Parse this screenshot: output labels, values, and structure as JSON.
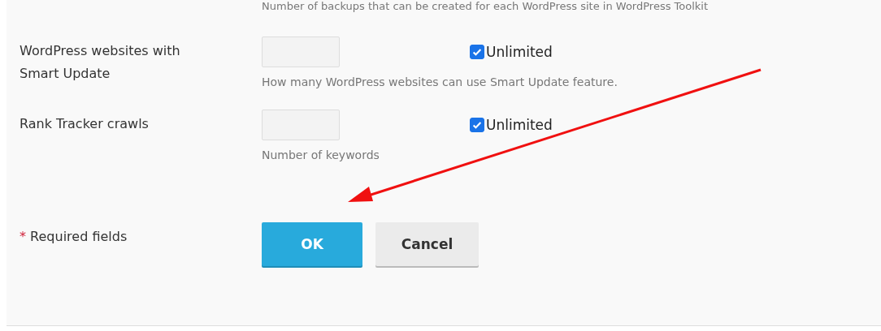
{
  "top_hint": "Number of backups that can be created for each WordPress site in WordPress Toolkit",
  "rows": [
    {
      "label": "WordPress websites with Smart Update",
      "unlimited": {
        "label": "Unlimited",
        "checked": true
      },
      "hint": "How many WordPress websites can use Smart Update feature."
    },
    {
      "label": "Rank Tracker crawls",
      "unlimited": {
        "label": "Unlimited",
        "checked": true
      },
      "hint": "Number of keywords"
    }
  ],
  "required": {
    "mark": "*",
    "label": "Required fields"
  },
  "buttons": [
    {
      "label": "OK",
      "kind": "primary"
    },
    {
      "label": "Cancel",
      "kind": "secondary"
    }
  ]
}
